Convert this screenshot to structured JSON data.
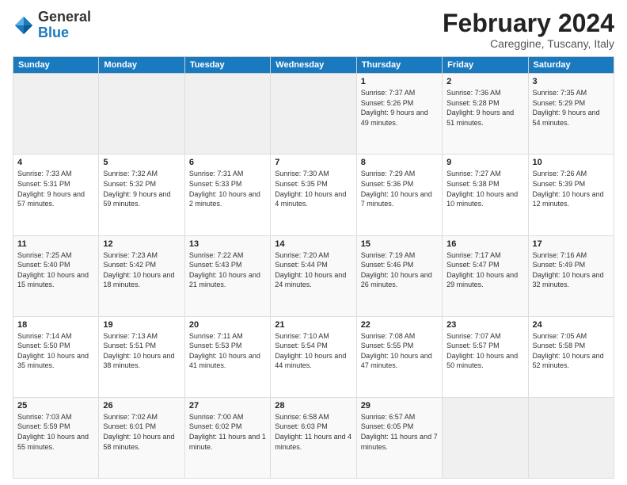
{
  "logo": {
    "general": "General",
    "blue": "Blue"
  },
  "header": {
    "title": "February 2024",
    "subtitle": "Careggine, Tuscany, Italy"
  },
  "weekdays": [
    "Sunday",
    "Monday",
    "Tuesday",
    "Wednesday",
    "Thursday",
    "Friday",
    "Saturday"
  ],
  "weeks": [
    [
      {
        "day": "",
        "info": ""
      },
      {
        "day": "",
        "info": ""
      },
      {
        "day": "",
        "info": ""
      },
      {
        "day": "",
        "info": ""
      },
      {
        "day": "1",
        "info": "Sunrise: 7:37 AM\nSunset: 5:26 PM\nDaylight: 9 hours and 49 minutes."
      },
      {
        "day": "2",
        "info": "Sunrise: 7:36 AM\nSunset: 5:28 PM\nDaylight: 9 hours and 51 minutes."
      },
      {
        "day": "3",
        "info": "Sunrise: 7:35 AM\nSunset: 5:29 PM\nDaylight: 9 hours and 54 minutes."
      }
    ],
    [
      {
        "day": "4",
        "info": "Sunrise: 7:33 AM\nSunset: 5:31 PM\nDaylight: 9 hours and 57 minutes."
      },
      {
        "day": "5",
        "info": "Sunrise: 7:32 AM\nSunset: 5:32 PM\nDaylight: 9 hours and 59 minutes."
      },
      {
        "day": "6",
        "info": "Sunrise: 7:31 AM\nSunset: 5:33 PM\nDaylight: 10 hours and 2 minutes."
      },
      {
        "day": "7",
        "info": "Sunrise: 7:30 AM\nSunset: 5:35 PM\nDaylight: 10 hours and 4 minutes."
      },
      {
        "day": "8",
        "info": "Sunrise: 7:29 AM\nSunset: 5:36 PM\nDaylight: 10 hours and 7 minutes."
      },
      {
        "day": "9",
        "info": "Sunrise: 7:27 AM\nSunset: 5:38 PM\nDaylight: 10 hours and 10 minutes."
      },
      {
        "day": "10",
        "info": "Sunrise: 7:26 AM\nSunset: 5:39 PM\nDaylight: 10 hours and 12 minutes."
      }
    ],
    [
      {
        "day": "11",
        "info": "Sunrise: 7:25 AM\nSunset: 5:40 PM\nDaylight: 10 hours and 15 minutes."
      },
      {
        "day": "12",
        "info": "Sunrise: 7:23 AM\nSunset: 5:42 PM\nDaylight: 10 hours and 18 minutes."
      },
      {
        "day": "13",
        "info": "Sunrise: 7:22 AM\nSunset: 5:43 PM\nDaylight: 10 hours and 21 minutes."
      },
      {
        "day": "14",
        "info": "Sunrise: 7:20 AM\nSunset: 5:44 PM\nDaylight: 10 hours and 24 minutes."
      },
      {
        "day": "15",
        "info": "Sunrise: 7:19 AM\nSunset: 5:46 PM\nDaylight: 10 hours and 26 minutes."
      },
      {
        "day": "16",
        "info": "Sunrise: 7:17 AM\nSunset: 5:47 PM\nDaylight: 10 hours and 29 minutes."
      },
      {
        "day": "17",
        "info": "Sunrise: 7:16 AM\nSunset: 5:49 PM\nDaylight: 10 hours and 32 minutes."
      }
    ],
    [
      {
        "day": "18",
        "info": "Sunrise: 7:14 AM\nSunset: 5:50 PM\nDaylight: 10 hours and 35 minutes."
      },
      {
        "day": "19",
        "info": "Sunrise: 7:13 AM\nSunset: 5:51 PM\nDaylight: 10 hours and 38 minutes."
      },
      {
        "day": "20",
        "info": "Sunrise: 7:11 AM\nSunset: 5:53 PM\nDaylight: 10 hours and 41 minutes."
      },
      {
        "day": "21",
        "info": "Sunrise: 7:10 AM\nSunset: 5:54 PM\nDaylight: 10 hours and 44 minutes."
      },
      {
        "day": "22",
        "info": "Sunrise: 7:08 AM\nSunset: 5:55 PM\nDaylight: 10 hours and 47 minutes."
      },
      {
        "day": "23",
        "info": "Sunrise: 7:07 AM\nSunset: 5:57 PM\nDaylight: 10 hours and 50 minutes."
      },
      {
        "day": "24",
        "info": "Sunrise: 7:05 AM\nSunset: 5:58 PM\nDaylight: 10 hours and 52 minutes."
      }
    ],
    [
      {
        "day": "25",
        "info": "Sunrise: 7:03 AM\nSunset: 5:59 PM\nDaylight: 10 hours and 55 minutes."
      },
      {
        "day": "26",
        "info": "Sunrise: 7:02 AM\nSunset: 6:01 PM\nDaylight: 10 hours and 58 minutes."
      },
      {
        "day": "27",
        "info": "Sunrise: 7:00 AM\nSunset: 6:02 PM\nDaylight: 11 hours and 1 minute."
      },
      {
        "day": "28",
        "info": "Sunrise: 6:58 AM\nSunset: 6:03 PM\nDaylight: 11 hours and 4 minutes."
      },
      {
        "day": "29",
        "info": "Sunrise: 6:57 AM\nSunset: 6:05 PM\nDaylight: 11 hours and 7 minutes."
      },
      {
        "day": "",
        "info": ""
      },
      {
        "day": "",
        "info": ""
      }
    ]
  ]
}
